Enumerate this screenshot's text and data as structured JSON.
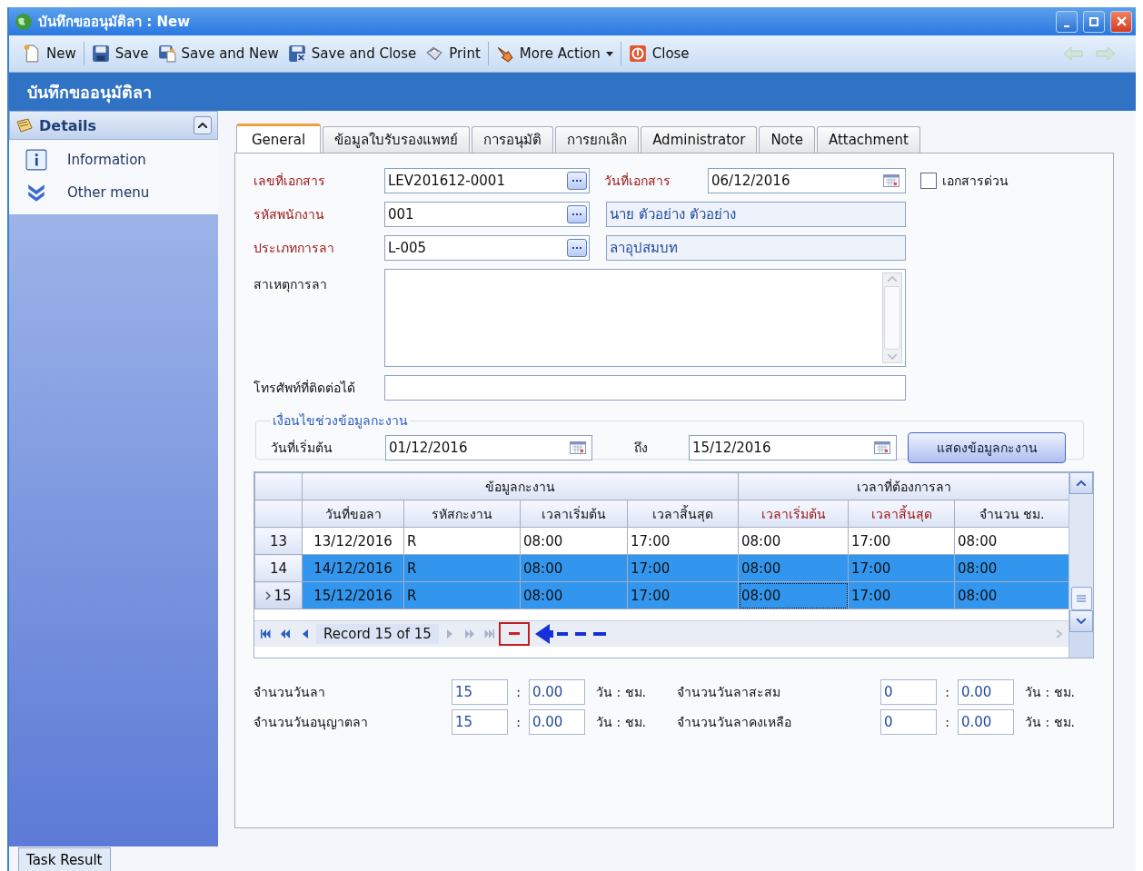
{
  "window": {
    "title": "บันทึกขออนุมัติลา : New"
  },
  "toolbar": {
    "buttons": [
      {
        "label": "New",
        "kind": "new"
      },
      {
        "label": "Save",
        "kind": "save"
      },
      {
        "label": "Save and New",
        "kind": "save-new"
      },
      {
        "label": "Save and Close",
        "kind": "save-close"
      },
      {
        "label": "Print",
        "kind": "print"
      },
      {
        "label": "More Action",
        "kind": "more"
      },
      {
        "label": "Close",
        "kind": "close"
      }
    ]
  },
  "page_title": "บันทึกขออนุมัติลา",
  "sidebar": {
    "title": "Details",
    "expanded": true,
    "items": [
      {
        "label": "Information",
        "kind": "info"
      },
      {
        "label": "Other menu",
        "kind": "more"
      }
    ]
  },
  "tabs": [
    {
      "label": "General",
      "selected": true
    },
    {
      "label": "ข้อมูลใบรับรองแพทย์",
      "selected": false
    },
    {
      "label": "การอนุมัติ",
      "selected": false
    },
    {
      "label": "การยกเลิก",
      "selected": false
    },
    {
      "label": "Administrator",
      "selected": false
    },
    {
      "label": "Note",
      "selected": false
    },
    {
      "label": "Attachment",
      "selected": false
    }
  ],
  "form": {
    "doc_no": {
      "label": "เลขที่เอกสาร",
      "value": "LEV201612-0001",
      "required": true
    },
    "doc_date": {
      "label": "วันที่เอกสาร",
      "value": "06/12/2016",
      "required": true
    },
    "urgent": {
      "label": "เอกสารด่วน",
      "checked": false
    },
    "employee": {
      "label": "รหัสพนักงาน",
      "value": "001",
      "name": "นาย ตัวอย่าง ตัวอย่าง",
      "required": true
    },
    "leave_type": {
      "label": "ประเภทการลา",
      "value": "L-005",
      "name": "ลาอุปสมบท",
      "required": true
    },
    "reason": {
      "label": "สาเหตุการลา",
      "required": false
    },
    "phone": {
      "label": "โทรศัพท์ที่ติดต่อได้",
      "required": false
    }
  },
  "shift_range": {
    "legend": "เงื่อนไขช่วงข้อมูลกะงาน",
    "start_label": "วันที่เริ่มต้น",
    "start_value": "01/12/2016",
    "end_label": "ถึง",
    "end_value": "15/12/2016",
    "button": "แสดงข้อมูลกะงาน"
  },
  "grid": {
    "groups": [
      {
        "label": "ข้อมูลกะงาน"
      },
      {
        "label": "เวลาที่ต้องการลา"
      }
    ],
    "columns": [
      {
        "label": "วันที่ขอลา",
        "required": false
      },
      {
        "label": "รหัสกะงาน",
        "required": false
      },
      {
        "label": "เวลาเริ่มต้น",
        "required": false
      },
      {
        "label": "เวลาสิ้นสุด",
        "required": false
      },
      {
        "label": "เวลาเริ่มต้น",
        "required": true
      },
      {
        "label": "เวลาสิ้นสุด",
        "required": true
      },
      {
        "label": "จำนวน ชม.",
        "required": false
      }
    ],
    "rows": [
      {
        "number": "13",
        "current": false,
        "selected": false,
        "cells": [
          "13/12/2016",
          "R",
          "08:00",
          "17:00",
          "08:00",
          "17:00",
          "08:00"
        ]
      },
      {
        "number": "14",
        "current": false,
        "selected": true,
        "cells": [
          "14/12/2016",
          "R",
          "08:00",
          "17:00",
          "08:00",
          "17:00",
          "08:00"
        ]
      },
      {
        "number": "15",
        "current": true,
        "selected": true,
        "cells": [
          "15/12/2016",
          "R",
          "08:00",
          "17:00",
          "08:00",
          "17:00",
          "08:00"
        ]
      }
    ],
    "navigator": {
      "record": "Record 15 of 15",
      "delete_highlighted": true
    }
  },
  "summary": [
    {
      "label": "จำนวนวันลา",
      "days": "15",
      "hours": "0.00",
      "separator": ":",
      "unit": "วัน : ชม."
    },
    {
      "label": "จำนวนวันลาสะสม",
      "days": "0",
      "hours": "0.00",
      "separator": ":",
      "unit": "วัน : ชม."
    },
    {
      "label": "จำนวนวันอนุญาตลา",
      "days": "15",
      "hours": "0.00",
      "separator": ":",
      "unit": "วัน : ชม."
    },
    {
      "label": "จำนวนวันลาคงเหลือ",
      "days": "0",
      "hours": "0.00",
      "separator": ":",
      "unit": "วัน : ชม."
    }
  ],
  "status_tab": {
    "label": "Task Result"
  }
}
